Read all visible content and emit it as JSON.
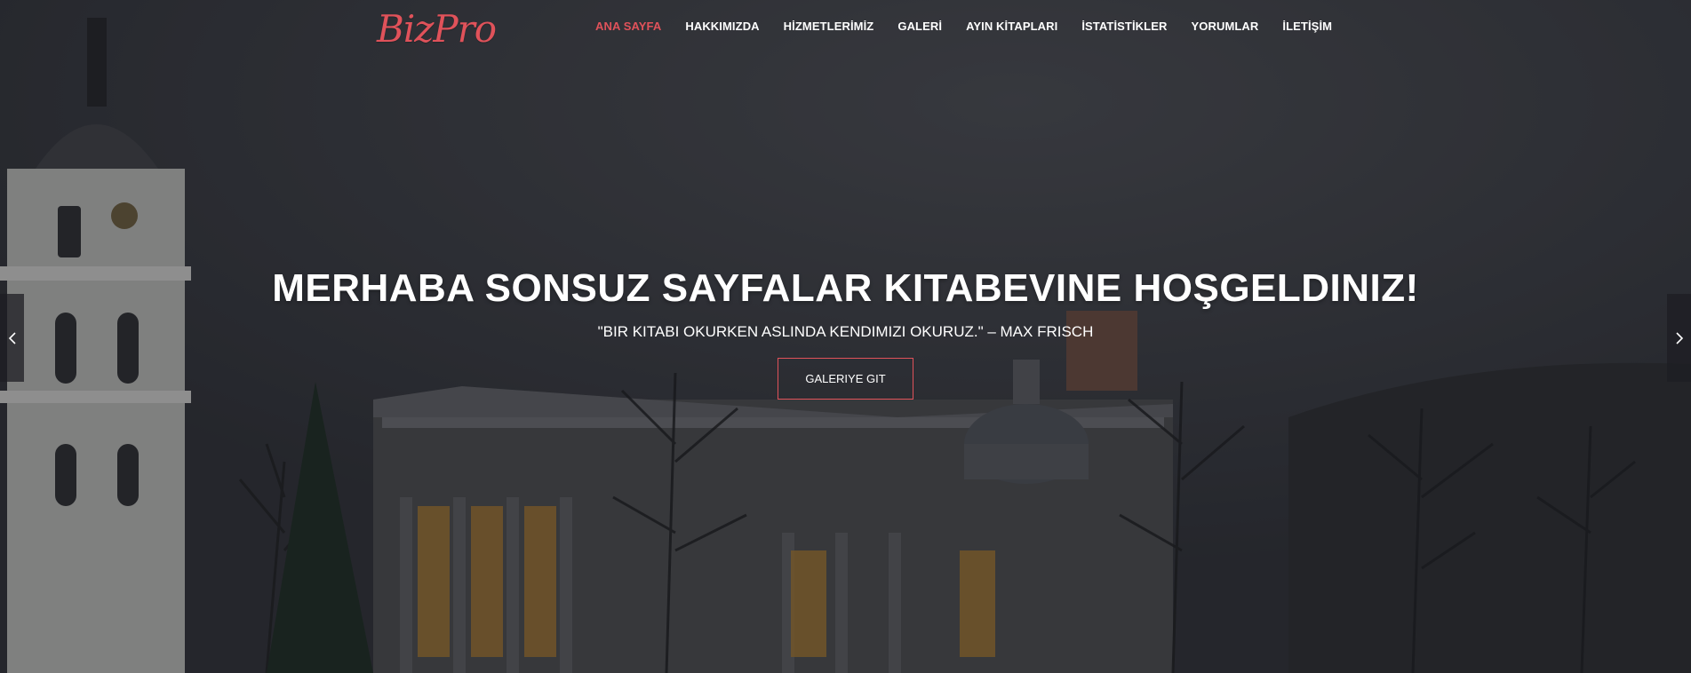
{
  "brand": {
    "logo_text": "BizPro",
    "accent_color": "#e0525a"
  },
  "nav": {
    "items": [
      {
        "label": "ANA SAYFA",
        "active": true
      },
      {
        "label": "HAKKIMIZDA",
        "active": false
      },
      {
        "label": "HİZMETLERİMİZ",
        "active": false
      },
      {
        "label": "GALERİ",
        "active": false
      },
      {
        "label": "AYIN KİTAPLARI",
        "active": false
      },
      {
        "label": "İSTATİSTİKLER",
        "active": false
      },
      {
        "label": "YORUMLAR",
        "active": false
      },
      {
        "label": "İLETİŞİM",
        "active": false
      }
    ]
  },
  "hero": {
    "title": "MERHABA SONSUZ SAYFALAR KITABEVINE HOŞGELDINIZ!",
    "quote": "\"BIR KITABI OKURKEN ASLINDA KENDIMIZI OKURUZ.\" – MAX FRISCH",
    "button_label": "GALERIYE GIT"
  },
  "slider": {
    "prev_icon": "chevron-left-icon",
    "next_icon": "chevron-right-icon"
  }
}
